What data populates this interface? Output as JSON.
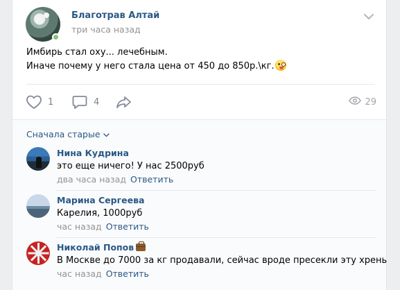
{
  "post": {
    "author": "Благотрав Алтай",
    "time": "три часа назад",
    "text_line1": "Имбирь стал оху... лечебным.",
    "text_line2": "Иначе почему у него стала цена от 450 до 850р.\\кг.",
    "emoji_icon": "tongue-wink-emoji",
    "likes": "1",
    "comments": "4",
    "views": "29"
  },
  "comments_section": {
    "sort_label": "Сначала старые",
    "reply_label": "Ответить",
    "items": [
      {
        "name": "Нина Кудрина",
        "text": "это еще ничего! У нас 2500руб",
        "time": "два часа назад"
      },
      {
        "name": "Марина Сергеева",
        "text": "Карелия, 1000руб",
        "time": "час назад"
      },
      {
        "name": "Николай Попов",
        "text": "В Москве до 7000 за кг продавали, сейчас вроде пресекли эту хрень",
        "time": "час назад",
        "badge_icon": "briefcase-icon"
      }
    ]
  },
  "colors": {
    "link": "#2a5885",
    "meta": "#939393",
    "icon": "#828282",
    "online": "#8ac176"
  }
}
